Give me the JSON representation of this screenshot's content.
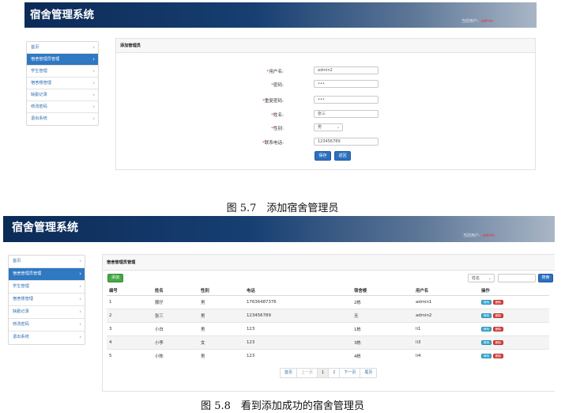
{
  "app_title": "宿舍管理系统",
  "user_label": "当前用户:",
  "user_name": "admin",
  "sidebar": {
    "items": [
      {
        "label": "首页"
      },
      {
        "label": "宿舍管理员管理"
      },
      {
        "label": "学生管理"
      },
      {
        "label": "宿舍楼管理"
      },
      {
        "label": "缺勤记录"
      },
      {
        "label": "修改密码"
      },
      {
        "label": "退出系统"
      }
    ],
    "active_index": 1
  },
  "figure1": {
    "caption": "图 5.7　添加宿舍管理员",
    "panel_title": "添加管理员",
    "required_mark": "*",
    "fields": {
      "username": {
        "label": "用户名:",
        "value": "admin2"
      },
      "password": {
        "label": "密码:",
        "value": "•••"
      },
      "confirm": {
        "label": "重复密码:",
        "value": "•••"
      },
      "name": {
        "label": "姓名:",
        "value": "张三"
      },
      "gender": {
        "label": "性别:",
        "value": "男"
      },
      "phone": {
        "label": "联系电话:",
        "value": "123456789"
      }
    },
    "save_label": "保存",
    "back_label": "返回"
  },
  "figure2": {
    "caption": "图 5.8　看到添加成功的宿舍管理员",
    "panel_title": "宿舍管理员管理",
    "add_label": "添加",
    "search_select": "姓名",
    "search_value": "",
    "search_label": "搜索",
    "columns": [
      "编号",
      "姓名",
      "性别",
      "电话",
      "宿舍楼",
      "用户名",
      "操作"
    ],
    "rows": [
      {
        "id": "1",
        "name": "靓仔",
        "gender": "男",
        "phone": "17636487376",
        "building": "2栋",
        "username": "admin1"
      },
      {
        "id": "2",
        "name": "张三",
        "gender": "男",
        "phone": "123456789",
        "building": "无",
        "username": "admin2"
      },
      {
        "id": "3",
        "name": "小白",
        "gender": "男",
        "phone": "123",
        "building": "1栋",
        "username": "li1"
      },
      {
        "id": "4",
        "name": "小李",
        "gender": "女",
        "phone": "123",
        "building": "3栋",
        "username": "li3"
      },
      {
        "id": "5",
        "name": "小陈",
        "gender": "男",
        "phone": "123",
        "building": "4栋",
        "username": "li4"
      }
    ],
    "edit_label": "修改",
    "delete_label": "删除",
    "pager": {
      "first": "首页",
      "prev": "上一页",
      "pages": [
        "1",
        "2"
      ],
      "next": "下一页",
      "last": "尾页",
      "current": "1"
    }
  }
}
